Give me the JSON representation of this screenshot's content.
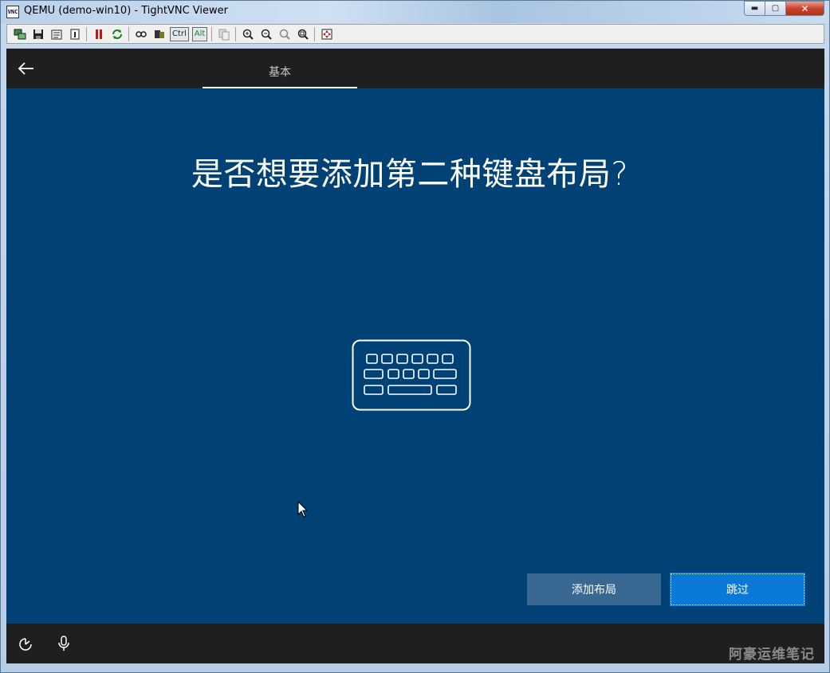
{
  "window": {
    "title": "QEMU (demo-win10) - TightVNC Viewer",
    "icon_text": "VNC",
    "min_glyph": "▬",
    "max_glyph": "▢",
    "close_glyph": "✕"
  },
  "toolbar": {
    "ctrl_label": "Ctrl",
    "alt_label": "Alt",
    "icons": [
      "new-connection-icon",
      "save-icon",
      "options-icon",
      "info-icon",
      "pause-icon",
      "refresh-icon",
      "send-keys-icon",
      "ctrl-alt-del-icon",
      "copy-icon",
      "zoom-in-icon",
      "zoom-out-icon",
      "zoom-100-icon",
      "zoom-fit-icon",
      "fullscreen-icon"
    ]
  },
  "oobe": {
    "tab_label": "基本",
    "heading": "是否想要添加第二种键盘布局?",
    "add_layout_button": "添加布局",
    "skip_button": "跳过"
  },
  "watermark": "阿豪运维笔记",
  "colors": {
    "background": "#004275",
    "bar": "#1f1f1f",
    "primary_button": "#0a78d7",
    "secondary_button": "#386791"
  }
}
